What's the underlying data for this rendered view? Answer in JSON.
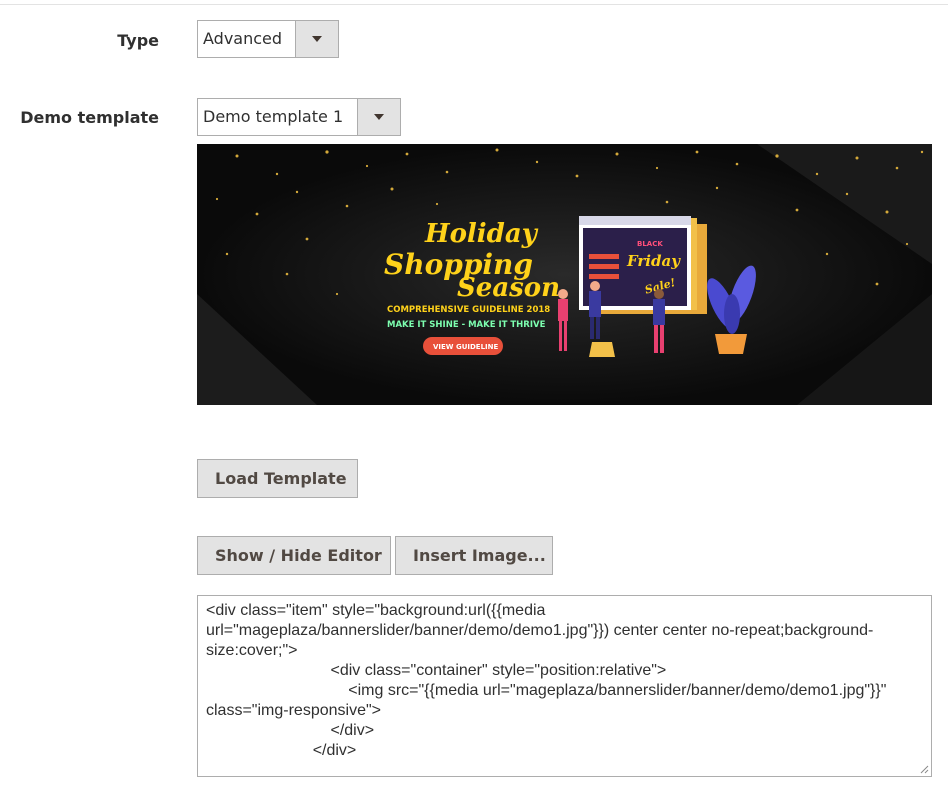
{
  "type_field": {
    "label": "Type",
    "value": "Advanced"
  },
  "demo_field": {
    "label": "Demo template",
    "value": "Demo template 1"
  },
  "banner": {
    "headline_1": "Holiday",
    "headline_2": "Shopping",
    "headline_3": "Season",
    "subtitle": "COMPREHENSIVE GUIDELINE 2018",
    "tagline": "MAKE IT SHINE - MAKE IT THRIVE",
    "cta": "VIEW GUIDELINE",
    "sign_1": "BLACK",
    "sign_2": "Friday",
    "sign_3": "Sale!"
  },
  "buttons": {
    "load_template": "Load Template",
    "show_hide_editor": "Show / Hide Editor",
    "insert_image": "Insert Image..."
  },
  "editor": {
    "content": "<div class=\"item\" style=\"background:url({{media url=\"mageplaza/bannerslider/banner/demo/demo1.jpg\"}}) center center no-repeat;background-size:cover;\">\n                            <div class=\"container\" style=\"position:relative\">\n                                <img src=\"{{media url=\"mageplaza/bannerslider/banner/demo/demo1.jpg\"}}\" class=\"img-responsive\">\n                            </div>\n                        </div>"
  },
  "colors": {
    "button_bg": "#e3e3e3",
    "border": "#adadad",
    "neon_yellow": "#ffd21a",
    "neon_green": "#7dffb0",
    "cta_red": "#e8503a"
  }
}
